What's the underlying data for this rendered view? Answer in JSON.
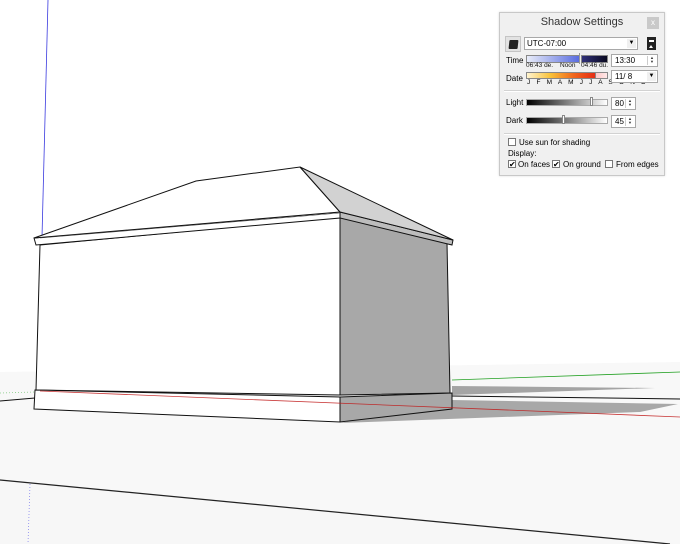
{
  "viewport": {
    "scene": "3D model of a hip-roofed rectangular building on a ground plane with cast shadows",
    "axis_colors": {
      "blue": "#3a3adf",
      "red": "#c01818",
      "green": "#22a022"
    },
    "colors": {
      "background": "#ffffff",
      "shaded_face": "#a8a8a8",
      "roof_side": "#d2d2d2",
      "shadow": "#a4a4a4",
      "ground": "#f8f8f8"
    }
  },
  "shadow_panel": {
    "title": "Shadow Settings",
    "close_label": "x",
    "timezone": "UTC-07:00",
    "time": {
      "label": "Time",
      "sunrise": "06:43 de.",
      "noon": "Noon",
      "sunset": "04:46 du.",
      "value": "13:30"
    },
    "date": {
      "label": "Date",
      "months": "J F M A M J J A S O N D",
      "value": "11/ 8"
    },
    "light": {
      "label": "Light",
      "value": "80",
      "fraction": 0.8
    },
    "dark": {
      "label": "Dark",
      "value": "45",
      "fraction": 0.45
    },
    "use_sun": {
      "label": "Use sun for shading",
      "checked": false
    },
    "display": {
      "label": "Display:",
      "on_faces": {
        "label": "On faces",
        "checked": true
      },
      "on_ground": {
        "label": "On ground",
        "checked": true
      },
      "from_edges": {
        "label": "From edges",
        "checked": false
      }
    },
    "check_glyph": "✔",
    "spin_up": "▲",
    "spin_down": "▼",
    "dropdown_arrow": "▼"
  }
}
